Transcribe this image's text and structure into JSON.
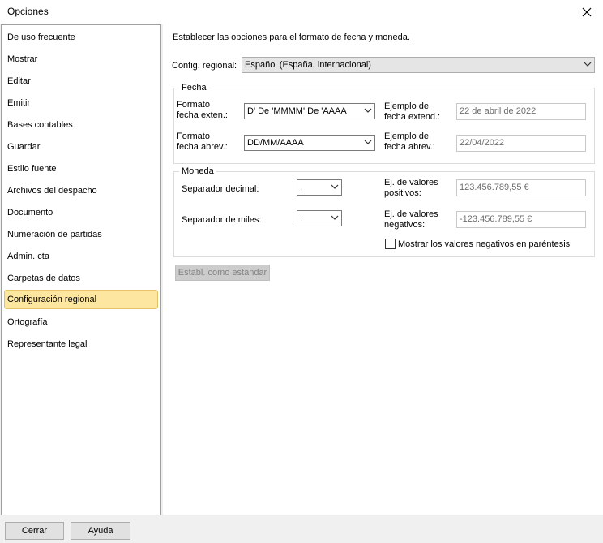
{
  "window": {
    "title": "Opciones"
  },
  "sidebar": {
    "items": [
      {
        "label": "De uso frecuente"
      },
      {
        "label": "Mostrar"
      },
      {
        "label": "Editar"
      },
      {
        "label": "Emitir"
      },
      {
        "label": "Bases contables"
      },
      {
        "label": "Guardar"
      },
      {
        "label": "Estilo fuente"
      },
      {
        "label": "Archivos del despacho"
      },
      {
        "label": "Documento"
      },
      {
        "label": "Numeración de partidas"
      },
      {
        "label": "Admin. cta"
      },
      {
        "label": "Carpetas de datos"
      },
      {
        "label": "Configuración regional",
        "selected": true
      },
      {
        "label": "Ortografía"
      },
      {
        "label": "Representante legal"
      }
    ]
  },
  "main": {
    "description": "Establecer las opciones para el formato de fecha y moneda.",
    "regional_label": "Config. regional:",
    "regional_value": "Español (España, internacional)",
    "fecha": {
      "title": "Fecha",
      "long_label_1": "Formato",
      "long_label_2": "fecha exten.:",
      "long_value": "D' De 'MMMM' De 'AAAA",
      "long_example_label_1": "Ejemplo de",
      "long_example_label_2": "fecha extend.:",
      "long_example_value": "22 de abril de 2022",
      "short_label_1": "Formato",
      "short_label_2": "fecha abrev.:",
      "short_value": "DD/MM/AAAA",
      "short_example_label_1": "Ejemplo de",
      "short_example_label_2": "fecha abrev.:",
      "short_example_value": "22/04/2022"
    },
    "moneda": {
      "title": "Moneda",
      "decimal_label": "Separador decimal:",
      "decimal_value": ",",
      "thousands_label": "Separador de miles:",
      "thousands_value": ".",
      "positive_label_1": "Ej. de valores",
      "positive_label_2": "positivos:",
      "positive_value": "123.456.789,55 €",
      "negative_label_1": "Ej. de valores",
      "negative_label_2": "negativos:",
      "negative_value": "-123.456.789,55 €",
      "parentheses_label": "Mostrar los valores negativos en paréntesis",
      "parentheses_checked": false
    },
    "default_button": "Establ. como estándar"
  },
  "footer": {
    "close_button": "Cerrar",
    "help_button": "Ayuda"
  }
}
